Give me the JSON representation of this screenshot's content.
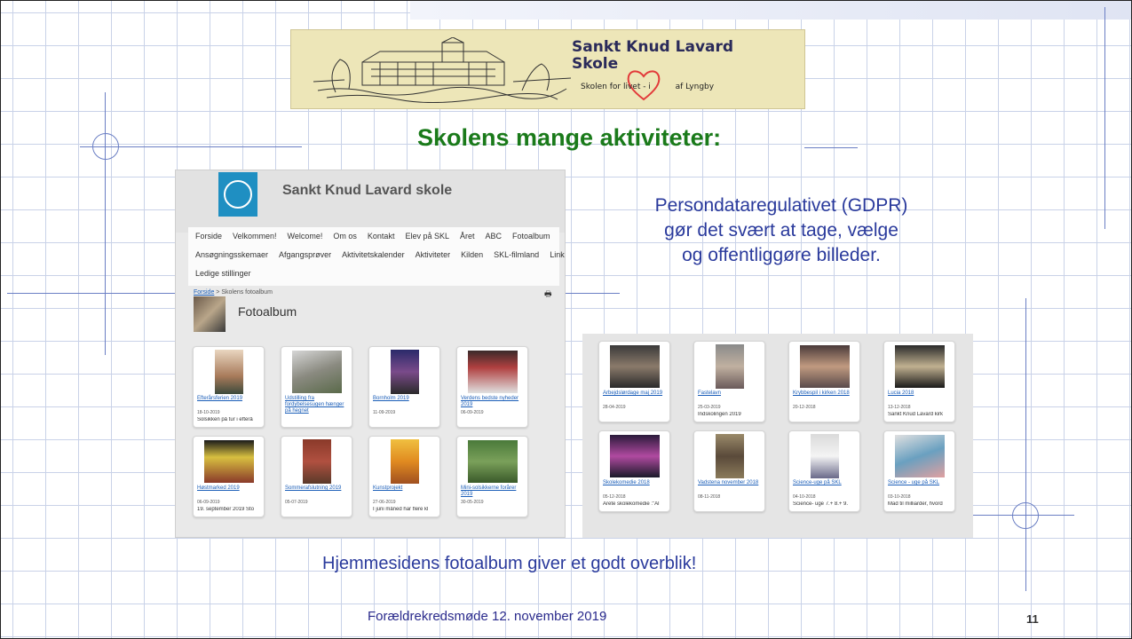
{
  "slide": {
    "logo": {
      "line1": "Sankt Knud Lavard",
      "line2": "Skole",
      "tagline": "Skolen for livet - i",
      "tagline_end": "af Lyngby",
      "heart_icon": "heart-icon",
      "accent_color": "#e23a3a"
    },
    "title": "Skolens mange aktiviteter:",
    "gdpr_text": [
      "Persondataregulativet (GDPR)",
      "gør det svært at tage, vælge",
      "og offentliggøre billeder."
    ],
    "caption": "Hjemmesidens fotoalbum giver et godt overblik!",
    "footer": "Forældrekredsmøde 12. november 2019",
    "page_number": "11",
    "title_color": "#1a7a1a",
    "text_color": "#2a3a9c"
  },
  "website": {
    "site_title": "Sankt Knud Lavard skole",
    "nav_row1": [
      "Forside",
      "Velkommen!",
      "Welcome!",
      "Om os",
      "Kontakt",
      "Elev på SKL",
      "Året",
      "ABC",
      "Fotoalbum"
    ],
    "nav_row2": [
      "Ansøgningsskemaer",
      "Afgangsprøver",
      "Aktivitetskalender",
      "Aktiviteter",
      "Kilden",
      "SKL-filmland",
      "Links"
    ],
    "nav_row3": [
      "Ledige stillinger"
    ],
    "breadcrumb_home": "Forside",
    "breadcrumb_current": " > Skolens fotoalbum",
    "album_heading": "Fotoalbum",
    "left_cards": [
      {
        "title": "Efterårsferien 2019",
        "date": "18-10-2019",
        "desc": "Solsikken på tur i efterå"
      },
      {
        "title": "Udstilling fra fordybelsesugen hænger på hegnet",
        "date": "",
        "desc": ""
      },
      {
        "title": "Bornholm 2019",
        "date": "11-09-2019",
        "desc": ""
      },
      {
        "title": "Verdens bedste nyheder 2019",
        "date": "06-09-2019",
        "desc": ""
      },
      {
        "title": "Høstmarked 2019",
        "date": "06-09-2019",
        "desc": "19. september 2019 Sto"
      },
      {
        "title": "Sommerafslutning 2019",
        "date": "05-07-2019",
        "desc": ""
      },
      {
        "title": "Kunstprojekt",
        "date": "27-06-2019",
        "desc": "I juni måned har flere kl"
      },
      {
        "title": "Mini-solsikkerne forårer 2019",
        "date": "30-05-2019",
        "desc": ""
      }
    ],
    "right_cards": [
      {
        "title": "Arbejdslørdage maj 2019",
        "date": "28-04-2019",
        "desc": ""
      },
      {
        "title": "Fastelavn",
        "date": "25-03-2019",
        "desc": "Indskolingen 2019"
      },
      {
        "title": "Krybbespil i kirken 2018",
        "date": "20-12-2018",
        "desc": ""
      },
      {
        "title": "Lucia 2018",
        "date": "13-12-2018",
        "desc": "Sankt Knud Lavard kirk"
      },
      {
        "title": "Skolekomedie 2018",
        "date": "05-12-2018",
        "desc": "Årete skolekomedie :\"Al"
      },
      {
        "title": "Vadstena november 2018",
        "date": "08-11-2018",
        "desc": ""
      },
      {
        "title": "Science-uge på SKL",
        "date": "04-10-2018",
        "desc": "Science- uge 7.+ 8.+ 9."
      },
      {
        "title": "Science - uge på SKL",
        "date": "03-10-2018",
        "desc": "Mad til milliarder, hvord"
      }
    ]
  }
}
